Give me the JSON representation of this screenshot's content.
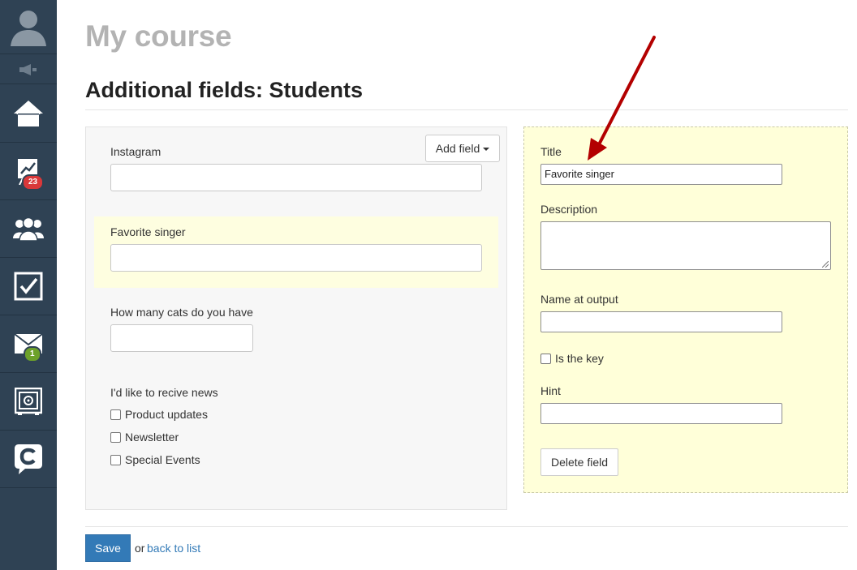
{
  "sidebar": {
    "badges": {
      "stats": "23",
      "mail": "1"
    },
    "icons": [
      "user-avatar-icon",
      "speaker-icon",
      "home-icon",
      "chart-icon",
      "users-icon",
      "checkbox-icon",
      "mail-icon",
      "safe-icon",
      "c-logo-icon"
    ]
  },
  "header": {
    "page_title": "My course",
    "section_title": "Additional fields: Students"
  },
  "form": {
    "add_field_label": "Add field",
    "fields": {
      "instagram": {
        "label": "Instagram",
        "value": ""
      },
      "favorite_singer": {
        "label": "Favorite singer",
        "value": ""
      },
      "cats": {
        "label": "How many cats do you have",
        "value": ""
      }
    },
    "news": {
      "label": "I'd like to recive news",
      "options": [
        "Product updates",
        "Newsletter",
        "Special Events"
      ]
    }
  },
  "editor": {
    "title_label": "Title",
    "title_value": "Favorite singer",
    "description_label": "Description",
    "output_name_label": "Name at output",
    "is_key_label": "Is the key",
    "hint_label": "Hint",
    "delete_label": "Delete field"
  },
  "footer": {
    "save_label": "Save",
    "or_text": "or",
    "back_label": "back to list"
  },
  "colors": {
    "sidebar_bg": "#2f4254",
    "highlight_bg": "#fefee0",
    "editor_bg": "#ffffd9",
    "primary": "#337ab7",
    "badge_red": "#d9383a",
    "badge_green": "#6da12a",
    "arrow": "#b30000"
  }
}
